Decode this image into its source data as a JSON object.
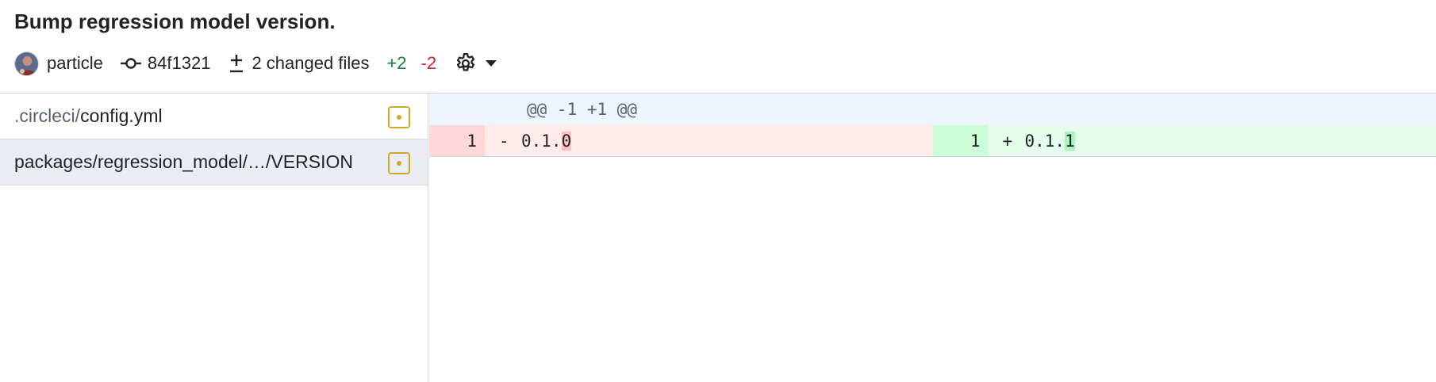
{
  "commit": {
    "title": "Bump regression model version.",
    "author": "particle",
    "sha": "84f1321",
    "changed_files_label": "2 changed files",
    "additions": "+2",
    "deletions": "-2"
  },
  "icons": {
    "commit": "git-commit-icon",
    "changed_files": "diff-plus-minus-icon",
    "settings": "gear-icon",
    "caret": "triangle-down-icon",
    "file_status": "file-modified-icon"
  },
  "colors": {
    "additions": "#1a7f37",
    "deletions": "#cf222e",
    "modified": "#d4a72c"
  },
  "files": [
    {
      "dir": ".circleci/",
      "name": "config.yml",
      "active": false
    },
    {
      "dir": "",
      "name": "packages/regression_model/…/VERSION",
      "active": true
    }
  ],
  "diff": {
    "hunk_header": "@@ -1 +1 @@",
    "lines": [
      {
        "left_num": "1",
        "left_marker": "-",
        "left_plain": "0.1.",
        "left_changed": "0",
        "right_num": "1",
        "right_marker": "+",
        "right_plain": "0.1.",
        "right_changed": "1"
      }
    ]
  }
}
